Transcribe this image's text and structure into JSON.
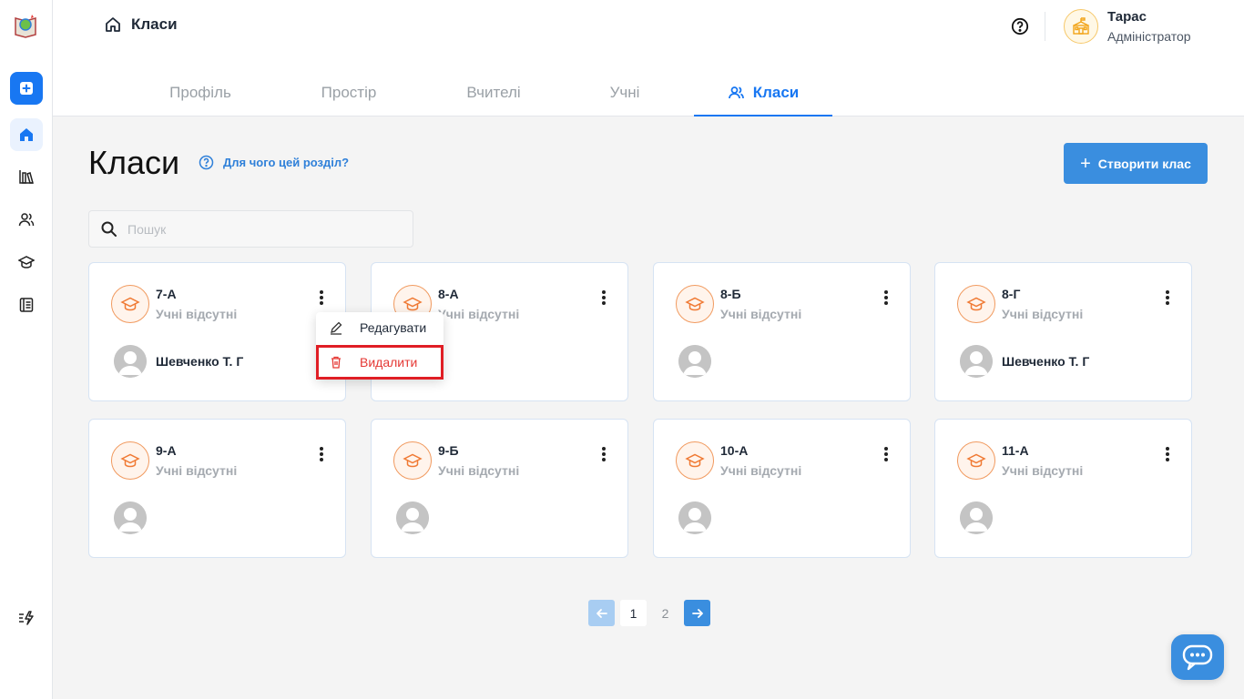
{
  "breadcrumb": {
    "label": "Класи"
  },
  "user": {
    "name": "Тарас",
    "role": "Адміністратор"
  },
  "tabs": [
    {
      "label": "Профіль"
    },
    {
      "label": "Простір"
    },
    {
      "label": "Вчителі"
    },
    {
      "label": "Учні"
    },
    {
      "label": "Класи",
      "active": true
    }
  ],
  "page": {
    "title": "Класи",
    "help_link": "Для чого цей розділ?"
  },
  "create_button": {
    "label": "Створити клас"
  },
  "search": {
    "placeholder": "Пошук",
    "value": ""
  },
  "cards": [
    {
      "name": "7-А",
      "status": "Учні відсутні",
      "teacher": "Шевченко Т. Г"
    },
    {
      "name": "8-А",
      "status": "Учні відсутні",
      "teacher": ""
    },
    {
      "name": "8-Б",
      "status": "Учні відсутні",
      "teacher": ""
    },
    {
      "name": "8-Г",
      "status": "Учні відсутні",
      "teacher": "Шевченко Т. Г"
    },
    {
      "name": "9-А",
      "status": "Учні відсутні",
      "teacher": ""
    },
    {
      "name": "9-Б",
      "status": "Учні відсутні",
      "teacher": ""
    },
    {
      "name": "10-А",
      "status": "Учні відсутні",
      "teacher": ""
    },
    {
      "name": "11-А",
      "status": "Учні відсутні",
      "teacher": ""
    }
  ],
  "context_menu": {
    "edit": "Редагувати",
    "delete": "Видалити"
  },
  "pagination": {
    "current": "1",
    "next_page": "2"
  },
  "colors": {
    "primary": "#1877f2",
    "button": "#3a8edf",
    "accent_orange": "#f19a5f",
    "danger": "#e53935"
  }
}
